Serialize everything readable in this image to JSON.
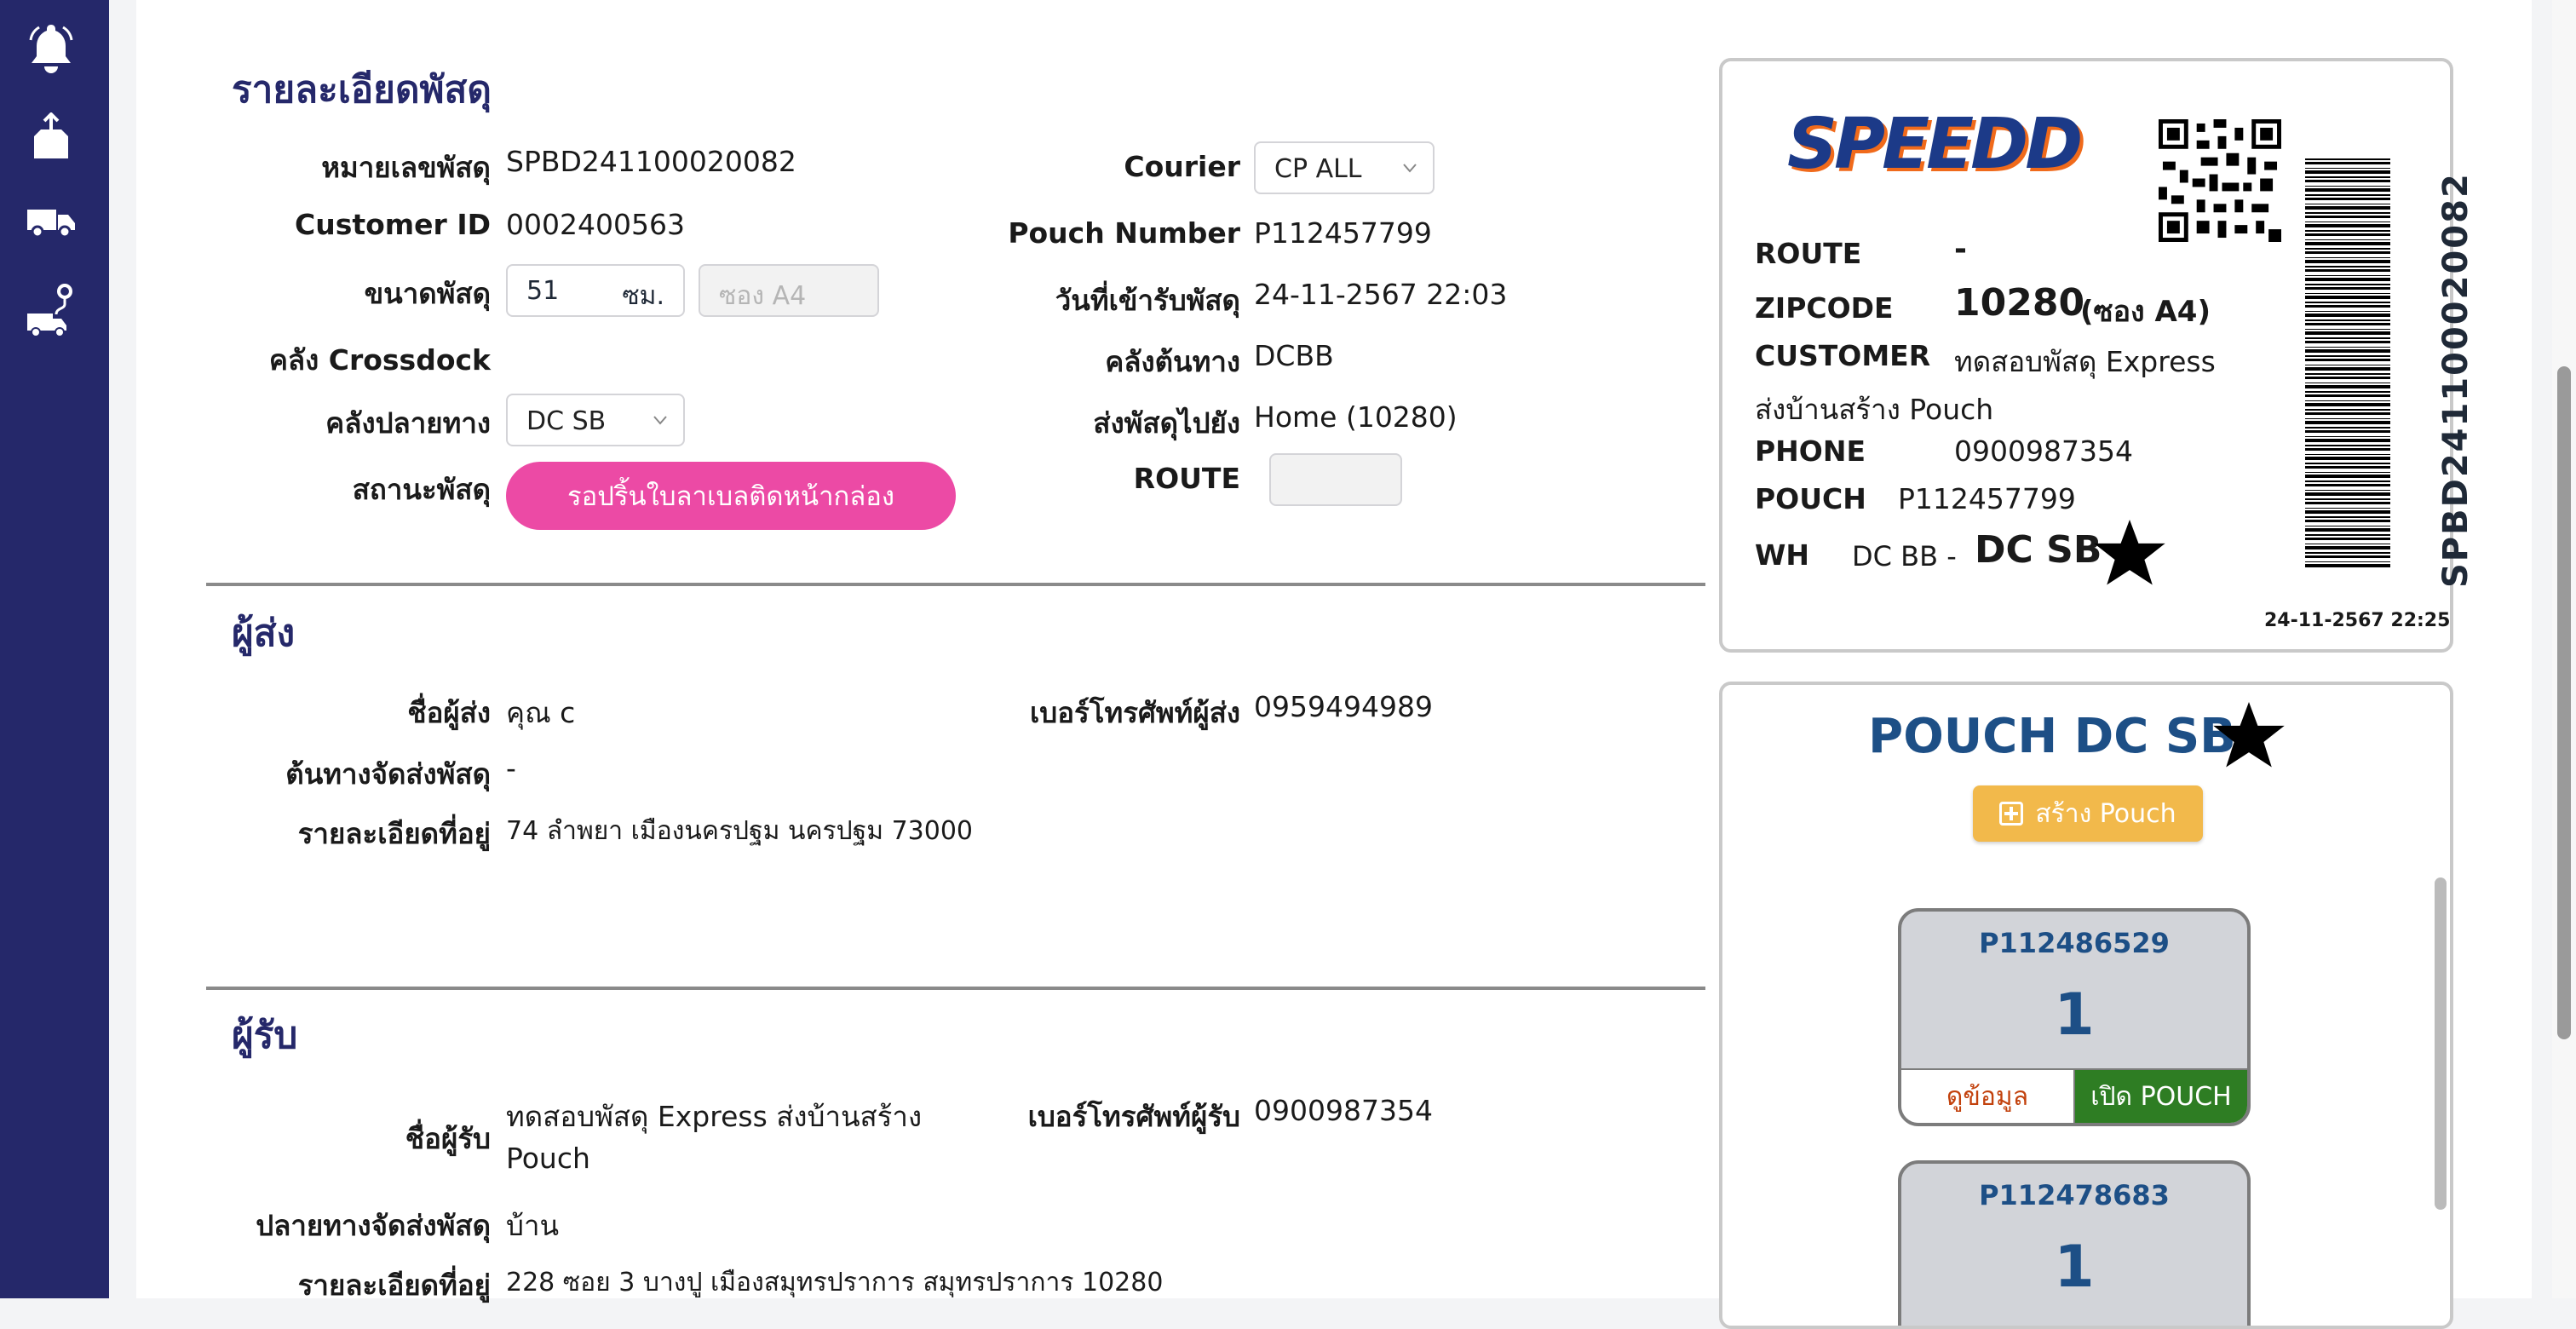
{
  "sidebar": {
    "icons": [
      "bell-icon",
      "parcel-upload-icon",
      "delivery-truck-icon",
      "route-truck-icon"
    ]
  },
  "parcel": {
    "section_title": "รายละเอียดพัสดุ",
    "tracking_label": "หมายเลขพัสดุ",
    "tracking_value": "SPBD241100020082",
    "customer_id_label": "Customer ID",
    "customer_id_value": "0002400563",
    "size_label": "ขนาดพัสดุ",
    "size_value": "51",
    "size_unit": "ซม.",
    "envelope_placeholder": "ซอง A4",
    "crossdock_label": "คลัง Crossdock",
    "dest_wh_label": "คลังปลายทาง",
    "dest_wh_value": "DC SB",
    "status_label": "สถานะพัสดุ",
    "status_value": "รอปริ้นใบลาเบลติดหน้ากล่อง",
    "courier_label": "Courier",
    "courier_value": "CP ALL",
    "pouch_number_label": "Pouch Number",
    "pouch_number_value": "P112457799",
    "received_date_label": "วันที่เข้ารับพัสดุ",
    "received_date_value": "24-11-2567 22:03",
    "origin_wh_label": "คลังต้นทาง",
    "origin_wh_value": "DCBB",
    "ship_to_label": "ส่งพัสดุไปยัง",
    "ship_to_value": "Home (10280)",
    "route_label": "ROUTE"
  },
  "sender": {
    "section_title": "ผู้ส่ง",
    "name_label": "ชื่อผู้ส่ง",
    "name_value": "คุณ c",
    "phone_label": "เบอร์โทรศัพท์ผู้ส่ง",
    "phone_value": "0959494989",
    "origin_label": "ต้นทางจัดส่งพัสดุ",
    "origin_value": "-",
    "address_label": "รายละเอียดที่อยู่",
    "address_value": "74 ลำพยา เมืองนครปฐม นครปฐม 73000"
  },
  "receiver": {
    "section_title": "ผู้รับ",
    "name_label": "ชื่อผู้รับ",
    "name_line1": "ทดสอบพัสดุ Express ส่งบ้านสร้าง",
    "name_line2": "Pouch",
    "phone_label": "เบอร์โทรศัพท์ผู้รับ",
    "phone_value": "0900987354",
    "destination_label": "ปลายทางจัดส่งพัสดุ",
    "destination_value": "บ้าน",
    "address_label": "รายละเอียดที่อยู่",
    "address_value": "228 ซอย 3 บางปู เมืองสมุทรปราการ สมุทรปราการ 10280"
  },
  "label_preview": {
    "logo_text": "SPEED",
    "logo_letter": "D",
    "route_key": "ROUTE",
    "route_value": "-",
    "zipcode_key": "ZIPCODE",
    "zipcode_value": "10280",
    "zipcode_note": "(ซอง A4)",
    "customer_key": "CUSTOMER",
    "customer_line1": "ทดสอบพัสดุ Express",
    "customer_line2": "ส่งบ้านสร้าง Pouch",
    "phone_key": "PHONE",
    "phone_value": "0900987354",
    "pouch_key": "POUCH",
    "pouch_value": "P112457799",
    "wh_key": "WH",
    "wh_from": "DC BB -",
    "wh_to": "DC SB",
    "barcode_text": "SPBD241100020082",
    "printed_at": "24-11-2567 22:25"
  },
  "pouch_panel": {
    "title": "POUCH DC SB",
    "create_button": "สร้าง Pouch",
    "items": [
      {
        "id": "P112486529",
        "count": "1",
        "view": "ดูข้อมูล",
        "open": "เปิด POUCH"
      },
      {
        "id": "P112478683",
        "count": "1"
      }
    ]
  },
  "colors": {
    "sidebar": "#25286a",
    "section_title": "#25286a",
    "status_pill": "#ec4aa5",
    "pouch_title": "#1d4f86",
    "create_button": "#f2b94b",
    "open_button": "#2e7d23"
  }
}
